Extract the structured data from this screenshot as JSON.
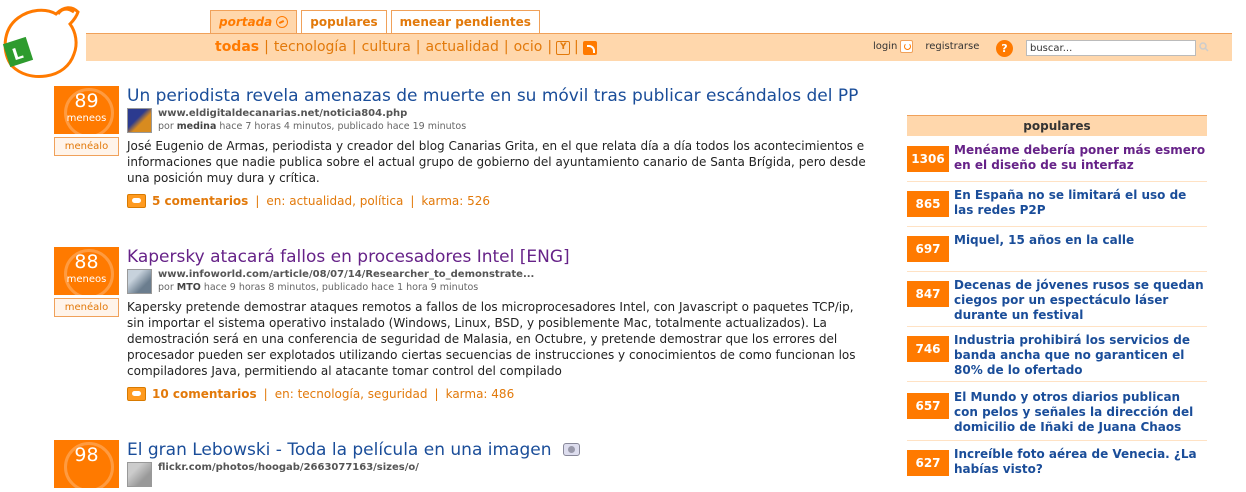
{
  "tabs": [
    {
      "label": "portada",
      "active": true
    },
    {
      "label": "populares",
      "active": false
    },
    {
      "label": "menear pendientes",
      "active": false
    }
  ],
  "nav": {
    "links": [
      "todas",
      "tecnología",
      "cultura",
      "actualidad",
      "ocio"
    ],
    "selected": "todas"
  },
  "user": {
    "login": "login",
    "register": "registrarse",
    "help": "?"
  },
  "search": {
    "value": "buscar..."
  },
  "colors": {
    "accent": "#ff7a00",
    "bar": "#ffd7ac",
    "link": "#1a4d99",
    "visited": "#662288"
  },
  "story_ui": {
    "votes_label": "meneos",
    "vote_button": "menéalo"
  },
  "stories": [
    {
      "votes": "89",
      "title": "Un periodista revela amenazas de muerte en su móvil tras publicar escándalos del PP",
      "url": "www.eldigitaldecanarias.net/noticia804.php",
      "by_prefix": "por",
      "author": "medina",
      "by_rest": "hace 7 horas 4 minutos, publicado hace 19 minutos",
      "description": "José Eugenio de Armas, periodista y creador del blog Canarias Grita, en el que relata día a día todos los acontecimientos e informaciones que nadie publica sobre el actual grupo de gobierno del ayuntamiento canario de Santa Brígida, pero desde una posición muy dura y crítica.",
      "comments": "5 comentarios",
      "category": "en: actualidad, política",
      "karma": "karma: 526"
    },
    {
      "votes": "88",
      "title": "Kapersky atacará fallos en procesadores Intel [ENG]",
      "url": "www.infoworld.com/article/08/07/14/Researcher_to_demonstrate...",
      "by_prefix": "por",
      "author": "MTO",
      "by_rest": "hace 9 horas 8 minutos, publicado hace 1 hora 9 minutos",
      "description": "Kapersky pretende demostrar ataques remotos a fallos de los microprocesadores Intel, con Javascript o paquetes TCP/ip, sin importar el sistema operativo instalado (Windows, Linux, BSD, y posiblemente Mac, totalmente actualizados). La demostración será en una conferencia de seguridad de Malasia, en Octubre, y pretende demostrar que los errores del procesador pueden ser explotados utilizando ciertas secuencias de instrucciones y conocimientos de como funcionan los compiladores Java, permitiendo al atacante tomar control del compilado",
      "comments": "10 comentarios",
      "category": "en: tecnología, seguridad",
      "karma": "karma: 486"
    },
    {
      "votes": "98",
      "title": "El gran Lebowski - Toda la película en una imagen",
      "url": "flickr.com/photos/hoogab/2663077163/sizes/o/"
    }
  ],
  "sidebar": {
    "title": "populares",
    "items": [
      {
        "votes": "1306",
        "text": "Menéame debería poner más esmero en el diseño de su interfaz"
      },
      {
        "votes": "865",
        "text": "En España no se limitará el uso de las redes P2P"
      },
      {
        "votes": "697",
        "text": "Miquel, 15 años en la calle"
      },
      {
        "votes": "847",
        "text": "Decenas de jóvenes rusos se quedan ciegos por un espectáculo láser durante un festival"
      },
      {
        "votes": "746",
        "text": "Industria prohibirá los servicios de banda ancha que no garanticen el 80% de lo ofertado"
      },
      {
        "votes": "657",
        "text": "El Mundo y otros diarios publican con pelos y señales la dirección del domicilio de Iñaki de Juana Chaos"
      },
      {
        "votes": "627",
        "text": "Increíble foto aérea de Venecia. ¿La habías visto?"
      }
    ]
  }
}
